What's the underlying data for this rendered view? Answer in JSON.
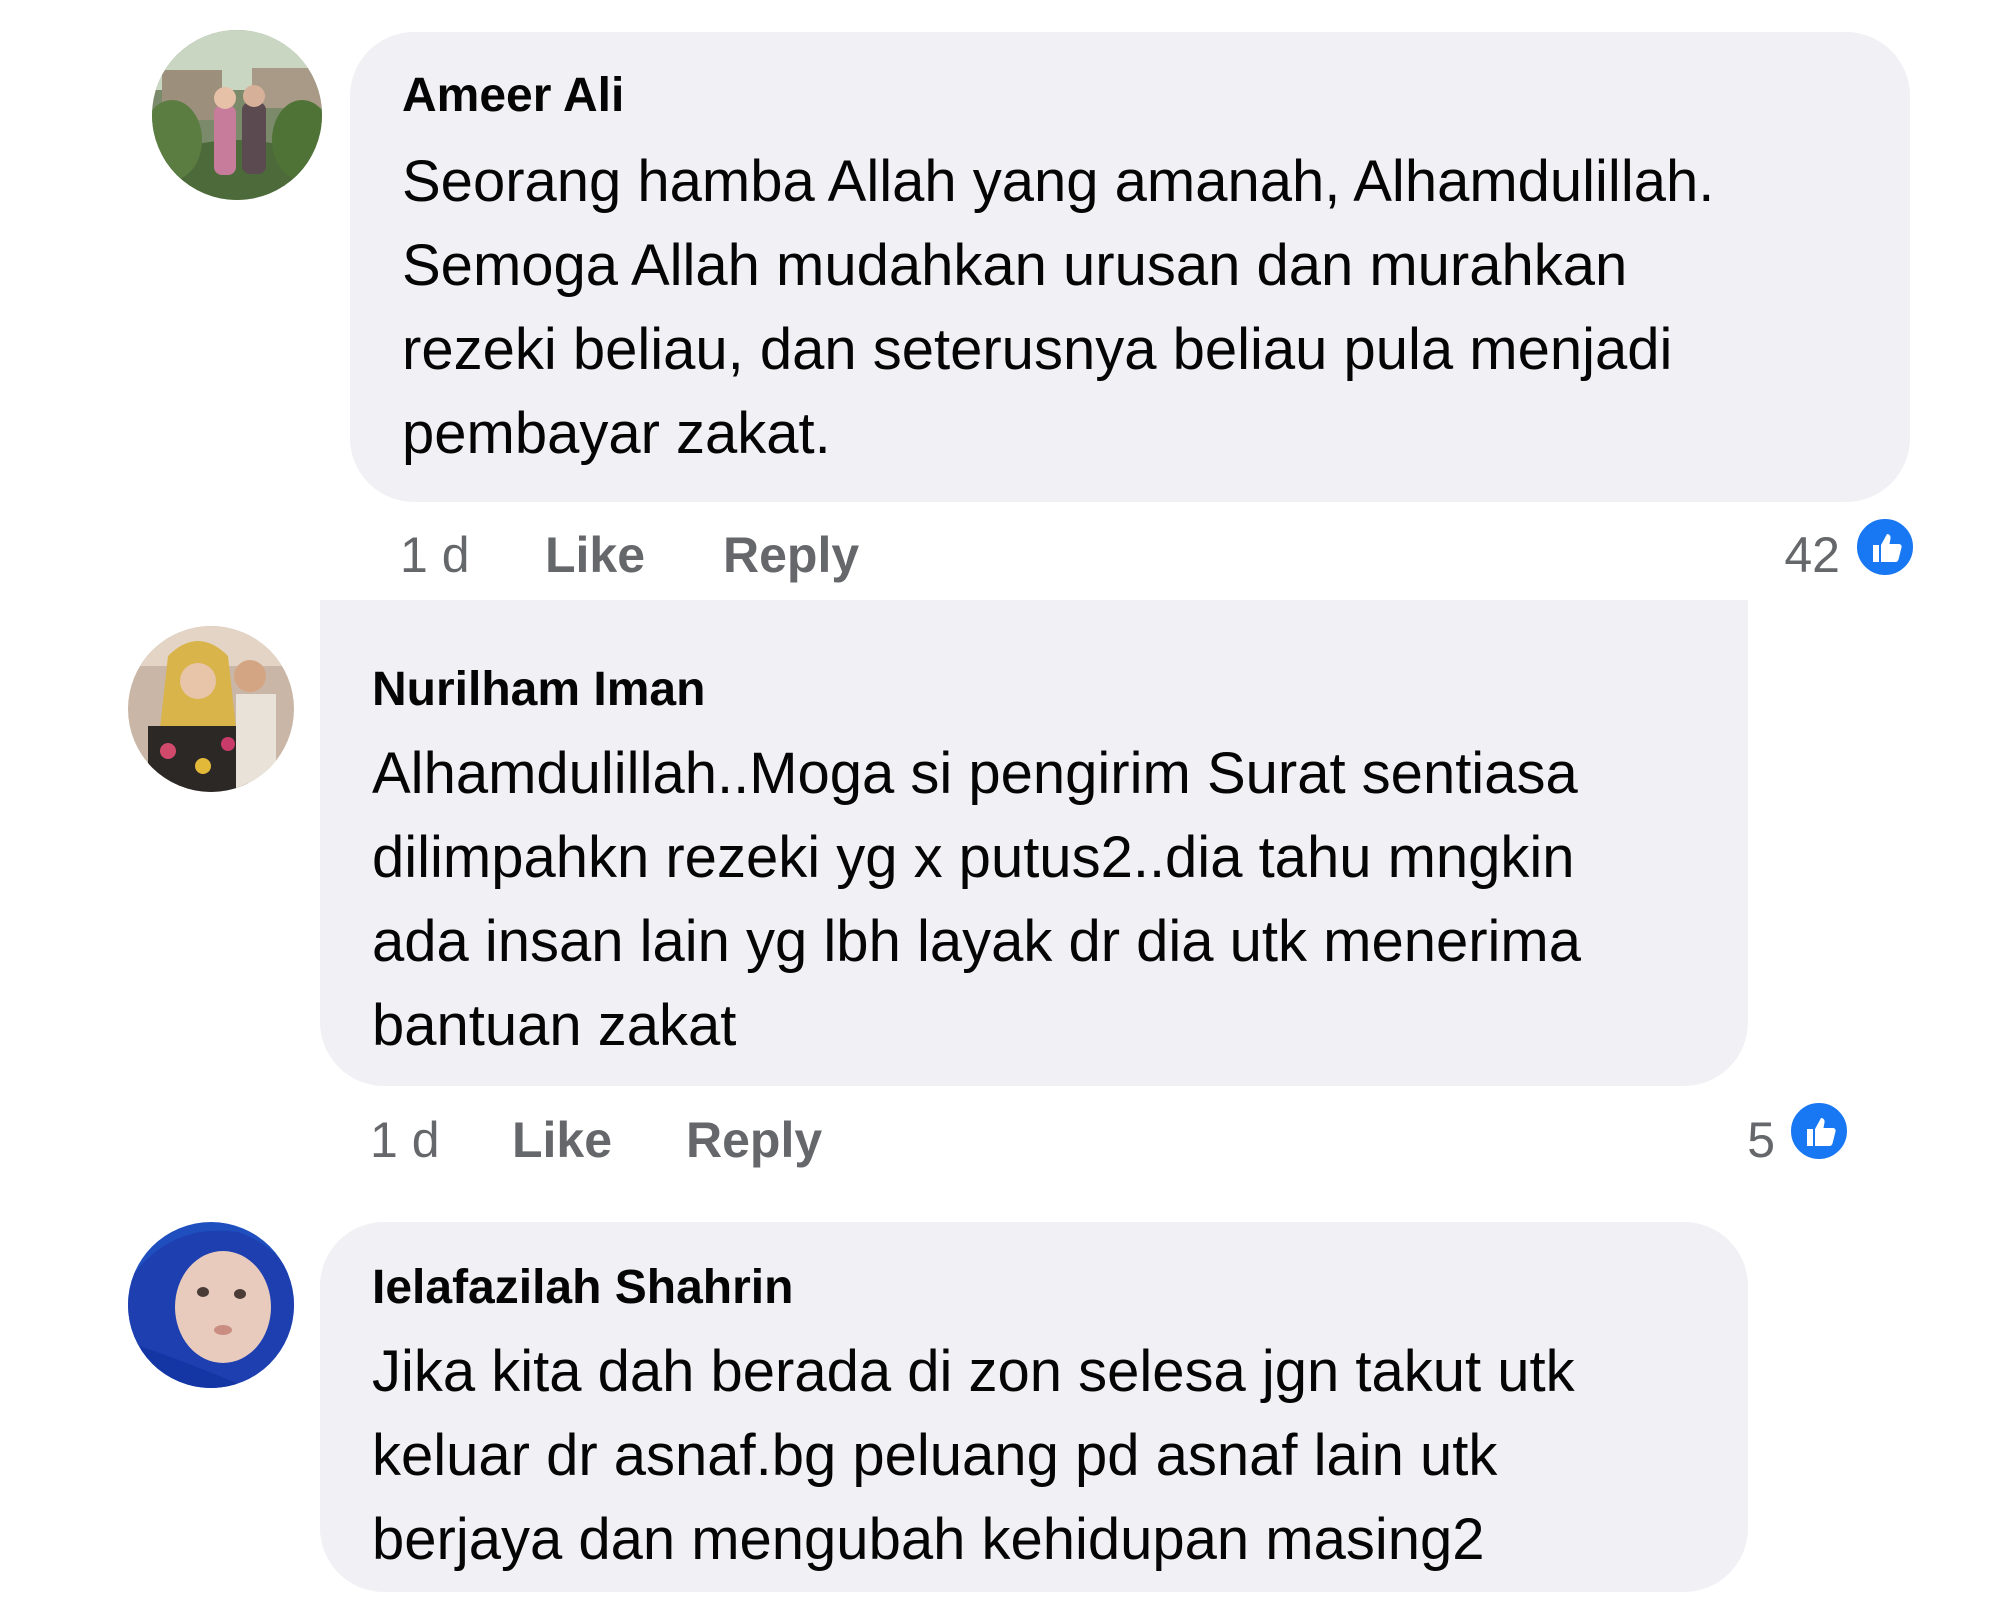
{
  "comments": [
    {
      "author": "Ameer Ali",
      "lines": [
        "Seorang hamba Allah yang amanah, Alhamdulillah.",
        "Semoga Allah mudahkan urusan dan murahkan",
        "rezeki beliau, dan seterusnya beliau pula menjadi",
        "pembayar zakat."
      ],
      "time": "1 d",
      "like_label": "Like",
      "reply_label": "Reply",
      "reaction_count": "42",
      "reaction_icon": "thumbs-up-icon"
    },
    {
      "author": "Nurilham Iman",
      "lines": [
        "Alhamdulillah..Moga si pengirim Surat sentiasa",
        "dilimpahkn rezeki yg x putus2..dia tahu mngkin",
        "ada insan lain yg lbh layak dr dia utk menerima",
        "bantuan zakat"
      ],
      "time": "1 d",
      "like_label": "Like",
      "reply_label": "Reply",
      "reaction_count": "5",
      "reaction_icon": "thumbs-up-icon"
    },
    {
      "author": "Ielafazilah Shahrin",
      "lines": [
        "Jika kita dah berada di zon selesa jgn takut utk",
        "keluar dr asnaf.bg peluang pd asnaf lain utk",
        "berjaya dan mengubah kehidupan masing2"
      ]
    }
  ],
  "colors": {
    "bubble": "#f0f0f5",
    "meta_text": "#65676b",
    "like_blue": "#1877f2"
  }
}
